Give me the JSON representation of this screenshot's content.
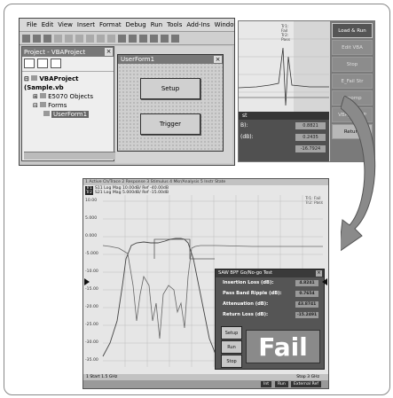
{
  "vba": {
    "menu": [
      "File",
      "Edit",
      "View",
      "Insert",
      "Format",
      "Debug",
      "Run",
      "Tools",
      "Add-Ins",
      "Window"
    ],
    "project_title": "Project - VBAProject",
    "tree": {
      "root": "VBAProject (Sample.vb",
      "objects": "E5070 Objects",
      "forms": "Forms",
      "form_item": "UserForm1"
    },
    "userform": {
      "title": "UserForm1",
      "setup_label": "Setup",
      "trigger_label": "Trigger"
    }
  },
  "analyzer": {
    "softkeys": [
      "Load & Run",
      "Edit VBA",
      "Stop",
      "E_Fail Str",
      "Prpomp",
      "VBA_SETUP",
      "Return"
    ],
    "trace_text": [
      "Tr1: Fail",
      "Tr2: Pass"
    ],
    "panel_title": "st",
    "rows": [
      {
        "label": "B):",
        "value": "0.8821"
      },
      {
        "label": "(dB):",
        "value": "0.2435"
      },
      {
        "label": "",
        "value": "-16.7924"
      }
    ]
  },
  "screen": {
    "top_menu": "1 Active Ch/Trace   2 Response   3 Stimulus   4 Mkr/Analysis   5 Instr State",
    "trace1": "S11 Log Mag 10.00dB/ Ref -40.00dB",
    "trace2": "S21 Log Mag 5.000dB/ Ref -15.00dB",
    "trace1_badge": "Tr1",
    "trace2_badge": "Tr2",
    "right_labels": [
      "Tr1: Fail",
      "Tr2: Pass"
    ],
    "y_ticks": [
      "10.00",
      "5.000",
      "0.000",
      "-5.000",
      "-10.00",
      "-15.00",
      "-20.00",
      "-25.00",
      "-30.00",
      "-35.00",
      "-40.00"
    ],
    "status_left": "1  Start 1.5 GHz",
    "status_right": "Stop 3 GHz",
    "bottom_tags": [
      "Int",
      "Run",
      "External Ref"
    ],
    "gonogo": {
      "title": "SAW BPF Go/No-go Test",
      "rows": [
        {
          "label": "Insertion Loss (dB):",
          "value": "4.8241"
        },
        {
          "label": "Pass Band Ripple (dB):",
          "value": "0.7654"
        },
        {
          "label": "Attenuation (dB):",
          "value": "43.8741"
        },
        {
          "label": "Return Loss (dB):",
          "value": "-15.2491"
        }
      ],
      "buttons": [
        "Setup",
        "Run",
        "Stop"
      ],
      "result": "Fail"
    }
  },
  "colors": {
    "window_gray": "#c8c8c8",
    "title_gray": "#777777",
    "dialog_dark": "#555555",
    "arrow_fill": "#8a8a8a"
  }
}
